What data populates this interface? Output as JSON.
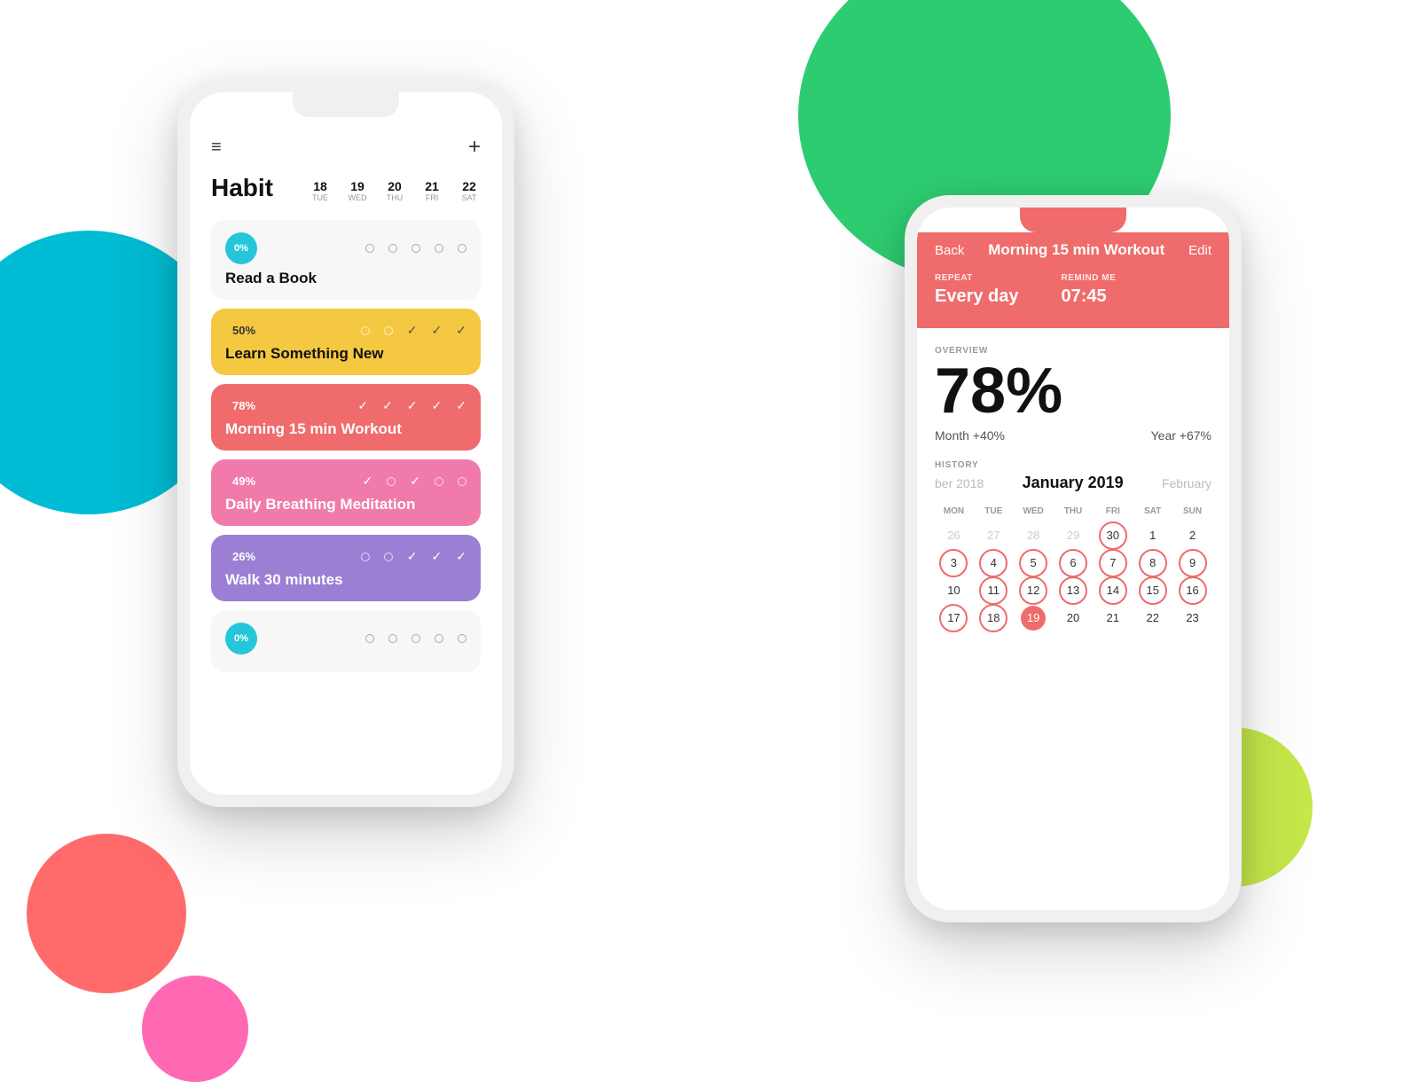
{
  "background": {
    "circles": [
      {
        "class": "bg-green"
      },
      {
        "class": "bg-cyan"
      },
      {
        "class": "bg-salmon"
      },
      {
        "class": "bg-pink"
      },
      {
        "class": "bg-lime"
      }
    ]
  },
  "phone_left": {
    "toolbar": {
      "menu_icon": "≡",
      "plus_icon": "+"
    },
    "header": {
      "title": "Habit",
      "dates": [
        {
          "num": "18",
          "day": "TUE"
        },
        {
          "num": "19",
          "day": "WED"
        },
        {
          "num": "20",
          "day": "THU"
        },
        {
          "num": "21",
          "day": "FRI"
        },
        {
          "num": "22",
          "day": "SAT"
        }
      ]
    },
    "habits": [
      {
        "id": "read-book",
        "percent": "0%",
        "name": "Read a Book",
        "color": "white",
        "badge_color": "teal",
        "checks": [
          "dot",
          "dot",
          "dot",
          "dot",
          "dot"
        ]
      },
      {
        "id": "learn-something",
        "percent": "50%",
        "name": "Learn Something New",
        "color": "yellow",
        "checks": [
          "dot",
          "dot",
          "check",
          "check",
          "check"
        ]
      },
      {
        "id": "morning-workout",
        "percent": "78%",
        "name": "Morning 15 min Workout",
        "color": "red",
        "checks": [
          "check",
          "check",
          "check",
          "check",
          "check"
        ]
      },
      {
        "id": "breathing-meditation",
        "percent": "49%",
        "name": "Daily Breathing Meditation",
        "color": "pink",
        "checks": [
          "check",
          "dot",
          "check",
          "dot",
          "dot"
        ]
      },
      {
        "id": "walk-30",
        "percent": "26%",
        "name": "Walk 30 minutes",
        "color": "purple",
        "checks": [
          "dot",
          "dot",
          "check",
          "check",
          "check"
        ]
      },
      {
        "id": "unknown",
        "percent": "0%",
        "name": "",
        "color": "white",
        "badge_color": "teal",
        "checks": [
          "dot",
          "dot",
          "dot",
          "dot",
          "dot"
        ]
      }
    ]
  },
  "phone_right": {
    "nav": {
      "back": "Back",
      "title": "Morning 15 min Workout",
      "edit": "Edit"
    },
    "repeat": {
      "label": "REPEAT",
      "value": "Every day"
    },
    "remind": {
      "label": "REMIND ME",
      "value": "07:45"
    },
    "overview": {
      "label": "OVERVIEW",
      "percent": "78%",
      "month": "Month +40%",
      "year": "Year +67%"
    },
    "history": {
      "label": "HISTORY",
      "prev_month": "ber 2018",
      "current_month": "January 2019",
      "next_month": "February",
      "days_header": [
        "MON",
        "TUE",
        "WED",
        "THU",
        "FRI",
        "SAT",
        "SUN"
      ],
      "weeks": [
        [
          {
            "num": "26",
            "type": "dim"
          },
          {
            "num": "27",
            "type": "dim"
          },
          {
            "num": "28",
            "type": "dim"
          },
          {
            "num": "29",
            "type": "dim"
          },
          {
            "num": "30",
            "type": "circled"
          },
          {
            "num": "1",
            "type": "normal"
          },
          {
            "num": "2",
            "type": "normal"
          }
        ],
        [
          {
            "num": "3",
            "type": "circled"
          },
          {
            "num": "4",
            "type": "circled"
          },
          {
            "num": "5",
            "type": "circled"
          },
          {
            "num": "6",
            "type": "circled"
          },
          {
            "num": "7",
            "type": "circled"
          },
          {
            "num": "8",
            "type": "circled"
          },
          {
            "num": "9",
            "type": "circled"
          }
        ],
        [
          {
            "num": "10",
            "type": "normal"
          },
          {
            "num": "11",
            "type": "circled"
          },
          {
            "num": "12",
            "type": "circled"
          },
          {
            "num": "13",
            "type": "circled"
          },
          {
            "num": "14",
            "type": "circled"
          },
          {
            "num": "15",
            "type": "circled"
          },
          {
            "num": "16",
            "type": "circled"
          }
        ],
        [
          {
            "num": "17",
            "type": "circled"
          },
          {
            "num": "18",
            "type": "circled"
          },
          {
            "num": "19",
            "type": "filled"
          },
          {
            "num": "20",
            "type": "normal"
          },
          {
            "num": "21",
            "type": "normal"
          },
          {
            "num": "22",
            "type": "normal"
          },
          {
            "num": "23",
            "type": "normal"
          }
        ]
      ]
    }
  }
}
